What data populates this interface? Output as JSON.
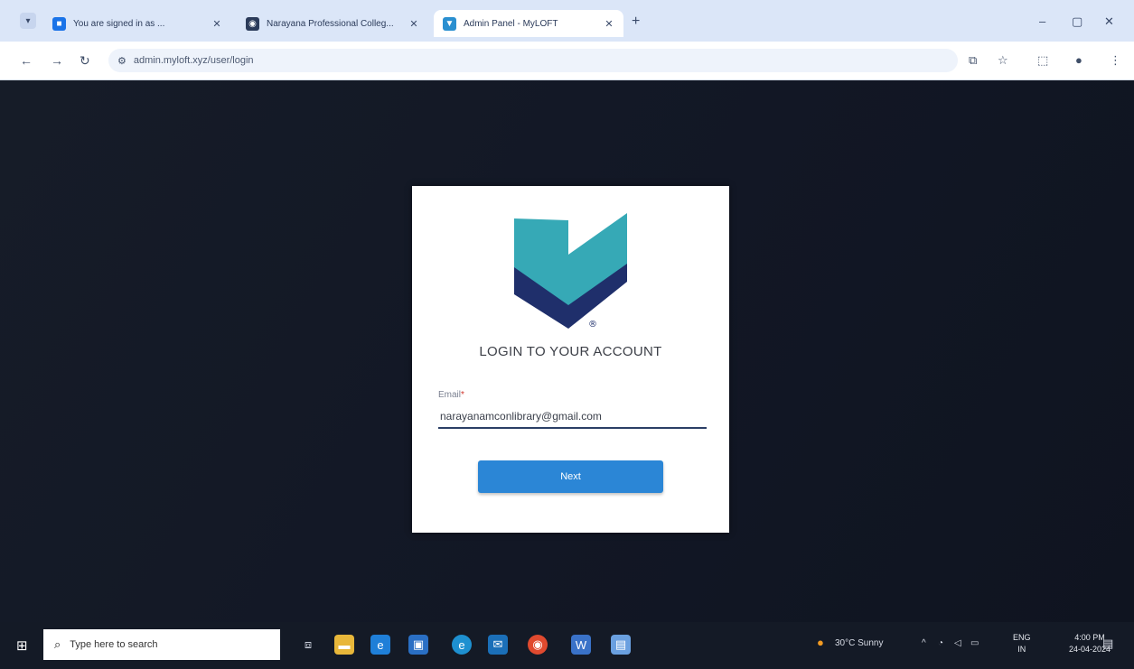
{
  "browser": {
    "tabs": [
      {
        "label": "You are signed in as ...",
        "active": false,
        "favicon": "app-icon",
        "color": "#1a73e8"
      },
      {
        "label": "Narayana Professional Colleg...",
        "active": false,
        "favicon": "globe-icon",
        "color": "#2b3b5a"
      },
      {
        "label": "Admin Panel - MyLOFT",
        "active": true,
        "favicon": "myloft-icon",
        "color": "#2a8fd0"
      }
    ],
    "new_tab_symbol": "+",
    "address": "admin.myloft.xyz/user/login",
    "window_controls": [
      "–",
      "▢",
      "✕"
    ]
  },
  "login_card": {
    "title": "LOGIN TO YOUR ACCOUNT",
    "email_label": "Email",
    "required_mark": "*",
    "email_value": "narayanamconlibrary@gmail.com",
    "next_button": "Next",
    "logo_colors": {
      "teal": "#36a9b6",
      "navy": "#1f2f6b"
    }
  },
  "taskbar": {
    "search_placeholder": "Type here to search",
    "weather": "30°C Sunny",
    "language": "ENG",
    "language_sub": "IN",
    "time": "4:00 PM",
    "date": "24-04-2024"
  }
}
